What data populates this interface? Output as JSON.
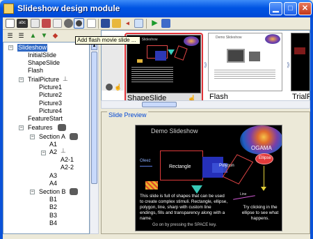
{
  "window": {
    "title": "Slideshow design module",
    "buttons": [
      "minimize",
      "maximize",
      "close"
    ]
  },
  "toolbar": {
    "tooltip": "Add flash movie slide ..."
  },
  "tree": {
    "nodes": [
      {
        "label": "Slideshow",
        "selected": true
      },
      {
        "label": "InitialSlide"
      },
      {
        "label": "ShapeSlide"
      },
      {
        "label": "Flash"
      },
      {
        "label": "TrialPicture"
      },
      {
        "label": "Picture1"
      },
      {
        "label": "Picture2"
      },
      {
        "label": "Picture3"
      },
      {
        "label": "Picture4"
      },
      {
        "label": "FeatureStart"
      },
      {
        "label": "Features"
      },
      {
        "label": "Section A"
      },
      {
        "label": "A1"
      },
      {
        "label": "A2"
      },
      {
        "label": "A2-1"
      },
      {
        "label": "A2-2"
      },
      {
        "label": "A3"
      },
      {
        "label": "A4"
      },
      {
        "label": "Section B"
      },
      {
        "label": "B1"
      },
      {
        "label": "B2"
      },
      {
        "label": "B3"
      },
      {
        "label": "B4"
      }
    ]
  },
  "thumbnails": [
    {
      "label": "ShapeSlide",
      "selected": true,
      "heading": "Demo Slideshow"
    },
    {
      "label": "Flash",
      "heading": "Demo Slideshow"
    },
    {
      "label": "TrialPictu"
    }
  ],
  "preview": {
    "group_title": "Slide Preview",
    "slide_title": "Demo Slideshow",
    "logo_text": "OGAMA",
    "shape_labels": {
      "ellipse": "Ellipse",
      "rectangle": "Rectangle",
      "polygon": "Polygon",
      "line": "Line",
      "small": "Oleez"
    },
    "body_text": "This slide is full of shapes that can be used to create complex stimuli. Rectangle, ellipse, polygon, line, sharp with custom line endings, fills and transparency along with a name.",
    "hint_text": "Try clicking in the ellipse to see what happens.",
    "continue_text": "Go on by pressing the SPACE key."
  },
  "colors": {
    "titlebar": "#0054e3",
    "selection": "#316ac5",
    "highlight_border": "#e0343a",
    "preview_title": "#0046d5"
  }
}
